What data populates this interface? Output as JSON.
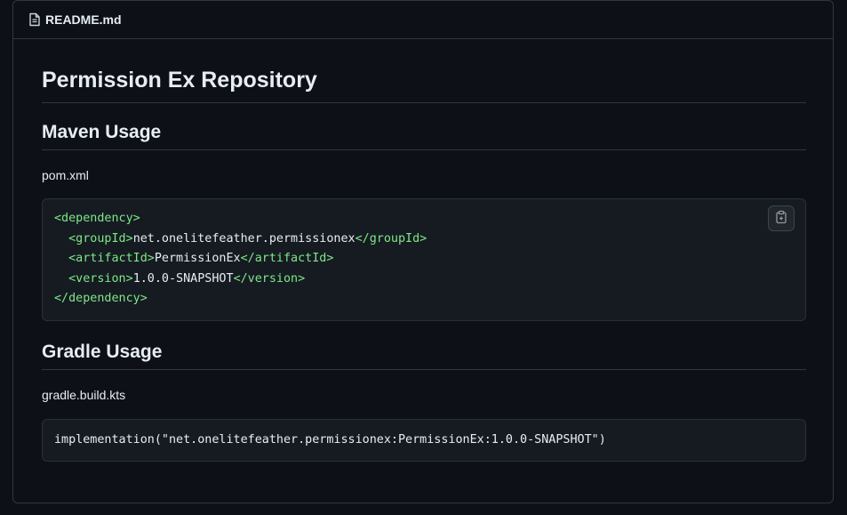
{
  "readme": {
    "filename": "README.md",
    "title": "Permission Ex Repository",
    "sections": [
      {
        "heading": "Maven Usage",
        "file_label": "pom.xml",
        "code_lines": [
          {
            "indent": "",
            "open": "<dependency>",
            "text": "",
            "close": ""
          },
          {
            "indent": "  ",
            "open": "<groupId>",
            "text": "net.onelitefeather.permissionex",
            "close": "</groupId>"
          },
          {
            "indent": "  ",
            "open": "<artifactId>",
            "text": "PermissionEx",
            "close": "</artifactId>"
          },
          {
            "indent": "  ",
            "open": "<version>",
            "text": "1.0.0-SNAPSHOT",
            "close": "</version>"
          },
          {
            "indent": "",
            "open": "</dependency>",
            "text": "",
            "close": ""
          }
        ]
      },
      {
        "heading": "Gradle Usage",
        "file_label": "gradle.build.kts",
        "code": "implementation(\"net.onelitefeather.permissionex:PermissionEx:1.0.0-SNAPSHOT\")"
      }
    ]
  },
  "icons": {
    "file": "file-icon",
    "copy": "copy-icon"
  },
  "colors": {
    "background": "#0d1117",
    "border": "#30363d",
    "code_background": "#161b22",
    "xml_tag": "#7ee787",
    "text": "#e6edf3"
  }
}
